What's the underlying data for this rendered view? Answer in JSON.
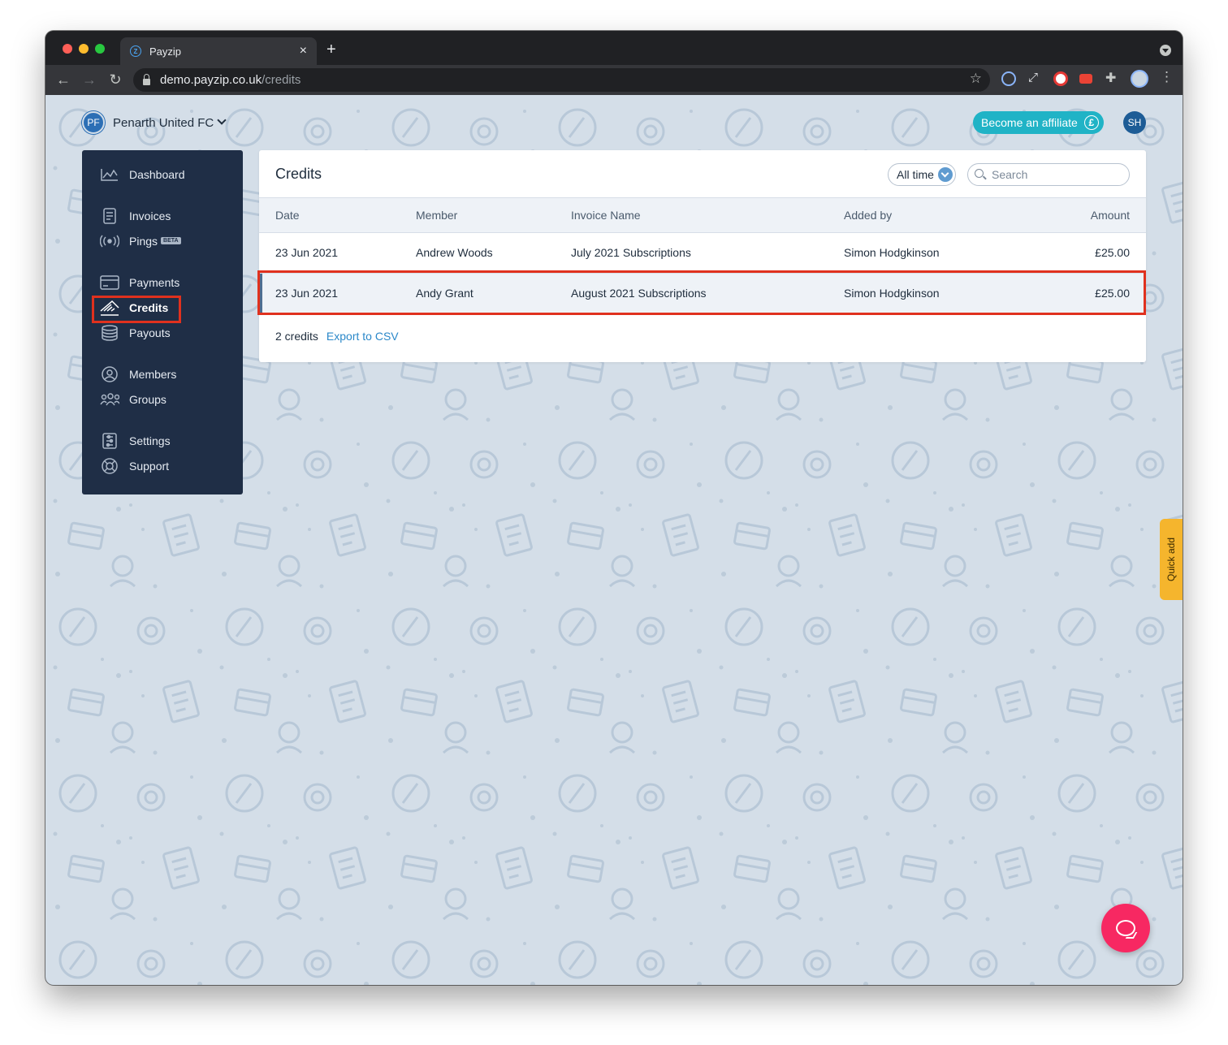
{
  "browser": {
    "tab_title": "Payzip",
    "tab_close": "×",
    "new_tab": "+",
    "url_host": "demo.payzip.co.uk",
    "url_path": "/credits"
  },
  "header": {
    "org_initials": "PF",
    "org_name": "Penarth United FC",
    "affiliate_label": "Become an affiliate",
    "affiliate_symbol": "£",
    "user_initials": "SH"
  },
  "sidebar": {
    "items": [
      {
        "label": "Dashboard",
        "icon": "chart-icon"
      },
      {
        "label": "Invoices",
        "icon": "invoice-icon"
      },
      {
        "label": "Pings",
        "icon": "broadcast-icon",
        "badge": "BETA"
      },
      {
        "label": "Payments",
        "icon": "card-icon"
      },
      {
        "label": "Credits",
        "icon": "credit-icon",
        "active": true
      },
      {
        "label": "Payouts",
        "icon": "coins-icon"
      },
      {
        "label": "Members",
        "icon": "user-icon"
      },
      {
        "label": "Groups",
        "icon": "group-icon"
      },
      {
        "label": "Settings",
        "icon": "settings-icon"
      },
      {
        "label": "Support",
        "icon": "lifebuoy-icon"
      }
    ]
  },
  "main": {
    "title": "Credits",
    "filter_value": "All time",
    "search_placeholder": "Search",
    "columns": [
      "Date",
      "Member",
      "Invoice Name",
      "Added by",
      "Amount"
    ],
    "rows": [
      {
        "date": "23 Jun 2021",
        "member": "Andrew Woods",
        "invoice": "July 2021 Subscriptions",
        "added_by": "Simon Hodgkinson",
        "amount": "£25.00"
      },
      {
        "date": "23 Jun 2021",
        "member": "Andy Grant",
        "invoice": "August 2021 Subscriptions",
        "added_by": "Simon Hodgkinson",
        "amount": "£25.00"
      }
    ],
    "count_text": "2 credits",
    "export_label": "Export to CSV"
  },
  "quick_add_label": "Quick add",
  "colors": {
    "sidebar_bg": "#1f2e46",
    "accent_teal": "#20b3c6",
    "highlight_red": "#e0311e",
    "quick_add": "#f5b52d",
    "chat": "#f72862"
  }
}
